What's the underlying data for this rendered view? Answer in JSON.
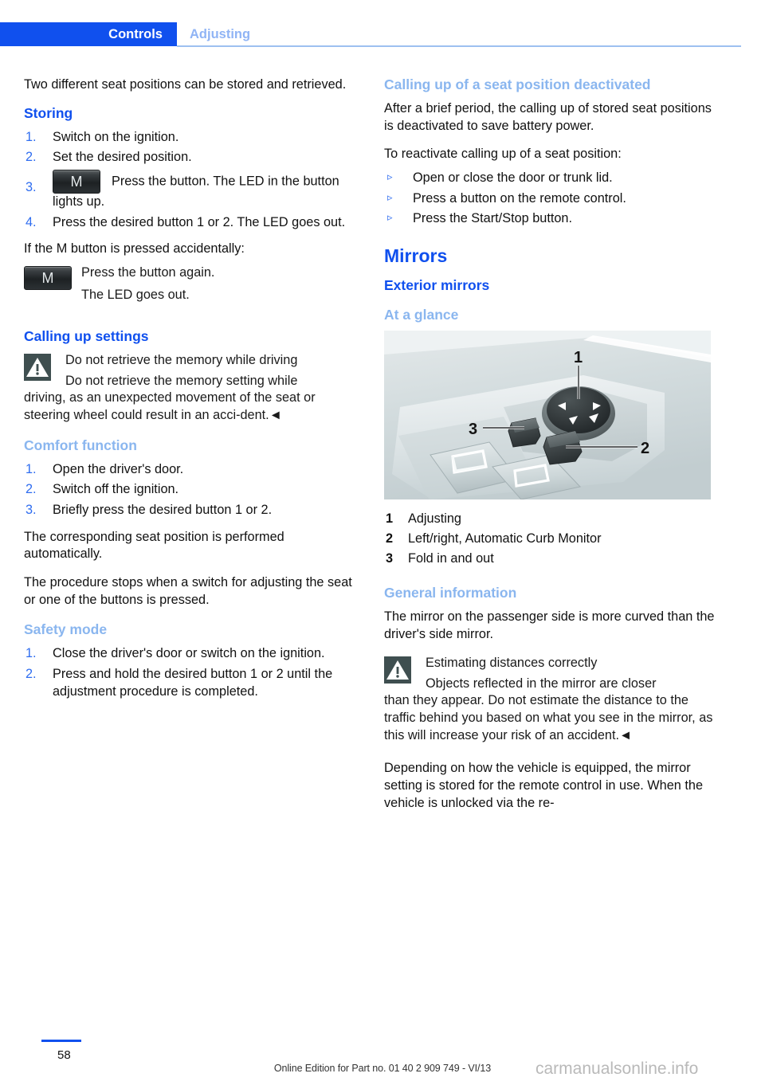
{
  "header": {
    "tab_active": "Controls",
    "tab_inactive": "Adjusting"
  },
  "colors": {
    "accent_blue": "#1050ee",
    "light_blue": "#8ab6ef",
    "rule_blue": "#9dc0f0",
    "warn_icon_bg": "#3f4f50",
    "m_button_bg": "#232729"
  },
  "left_column": {
    "intro": "Two different seat positions can be stored and retrieved.",
    "storing": {
      "heading": "Storing",
      "steps": [
        {
          "num": "1.",
          "text": "Switch on the ignition."
        },
        {
          "num": "2.",
          "text": "Set the desired position."
        },
        {
          "num": "3.",
          "icon": "m-button-icon",
          "text": "Press the button. The LED in the button lights up."
        },
        {
          "num": "4.",
          "text": "Press the desired button 1 or 2. The LED goes out."
        }
      ],
      "accidental_intro": "If the M button is pressed accidentally:",
      "accidental_icon": "m-button-icon",
      "accidental_line1": "Press the button again.",
      "accidental_line2": "The LED goes out."
    },
    "calling_up_settings": {
      "heading": "Calling up settings",
      "warning_icon": "warning-triangle-icon",
      "warning_title": "Do not retrieve the memory while driving",
      "warning_body_first": "Do not retrieve the memory setting while",
      "warning_body_rest": "driving, as an unexpected movement of the seat or steering wheel could result in an acci-dent.◄"
    },
    "comfort_function": {
      "heading": "Comfort function",
      "steps": [
        {
          "num": "1.",
          "text": "Open the driver's door."
        },
        {
          "num": "2.",
          "text": "Switch off the ignition."
        },
        {
          "num": "3.",
          "text": "Briefly press the desired button 1 or 2."
        }
      ],
      "para1": "The corresponding seat position is performed automatically.",
      "para2": "The procedure stops when a switch for adjusting the seat or one of the buttons is pressed."
    },
    "safety_mode": {
      "heading": "Safety mode",
      "steps": [
        {
          "num": "1.",
          "text": "Close the driver's door or switch on the ignition."
        },
        {
          "num": "2.",
          "text": "Press and hold the desired button 1 or 2 until the adjustment procedure is completed."
        }
      ]
    }
  },
  "right_column": {
    "calling_deactivated": {
      "heading": "Calling up of a seat position deactivated",
      "para1": "After a brief period, the calling up of stored seat positions is deactivated to save battery power.",
      "para2": "To reactivate calling up of a seat position:",
      "bullets": [
        {
          "marker": "▹",
          "text": "Open or close the door or trunk lid."
        },
        {
          "marker": "▹",
          "text": "Press a button on the remote control."
        },
        {
          "marker": "▹",
          "text": "Press the Start/Stop button."
        }
      ]
    },
    "mirrors": {
      "heading": "Mirrors",
      "sub_heading": "Exterior mirrors",
      "at_a_glance": "At a glance",
      "figure": {
        "alt": "door-panel-mirror-control-switches",
        "callouts": [
          "1",
          "2",
          "3"
        ]
      },
      "legend": [
        {
          "num": "1",
          "text": "Adjusting"
        },
        {
          "num": "2",
          "text": "Left/right, Automatic Curb Monitor"
        },
        {
          "num": "3",
          "text": "Fold in and out"
        }
      ],
      "general_information": {
        "heading": "General information",
        "para1": "The mirror on the passenger side is more curved than the driver's side mirror.",
        "warning_icon": "warning-triangle-icon",
        "warning_title": "Estimating distances correctly",
        "warning_body_first": "Objects reflected in the mirror are closer",
        "warning_body_rest": "than they appear. Do not estimate the distance to the traffic behind you based on what you see in the mirror, as this will increase your risk of an accident.◄",
        "para2": "Depending on how the vehicle is equipped, the mirror setting is stored for the remote control in use. When the vehicle is unlocked via the re-"
      }
    }
  },
  "footer": {
    "page_number": "58",
    "edition": "Online Edition for Part no. 01 40 2 909 749 - VI/13",
    "watermark": "carmanualsonline.info"
  },
  "icons": {
    "m_button_glyph": "M"
  }
}
